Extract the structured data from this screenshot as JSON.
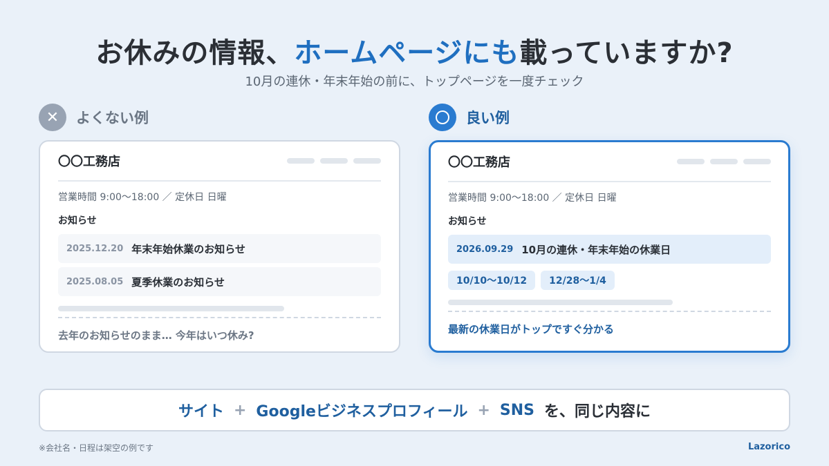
{
  "title": {
    "part1": "お休みの情報、",
    "accent": "ホームページにも",
    "part2": "載っていますか?"
  },
  "subtitle": "10月の連休・年末年始の前に、トップページを一度チェック",
  "bad": {
    "badge_icon": "✕",
    "label": "よくない例",
    "site_name": "〇〇工務店",
    "hours": "営業時間 9:00〜18:00 ／ 定休日 日曜",
    "notice_heading": "お知らせ",
    "news": [
      {
        "date": "2025.12.20",
        "text": "年末年始休業のお知らせ"
      },
      {
        "date": "2025.08.05",
        "text": "夏季休業のお知らせ"
      }
    ],
    "footer": "去年のお知らせのまま… 今年はいつ休み?"
  },
  "good": {
    "label": "良い例",
    "site_name": "〇〇工務店",
    "hours": "営業時間 9:00〜18:00 ／ 定休日 日曜",
    "notice_heading": "お知らせ",
    "news": [
      {
        "date": "2026.09.29",
        "text": "10月の連休・年末年始の休業日"
      }
    ],
    "tags": [
      "10/10〜10/12",
      "12/28〜1/4"
    ],
    "footer": "最新の休業日がトップですぐ分かる"
  },
  "banner": {
    "site": "サイト",
    "plus": "+",
    "google": "Googleビジネスプロフィール",
    "sns": "SNS",
    "suffix": "を、同じ内容に"
  },
  "note": "※会社名・日程は架空の例です",
  "brand": "Lazorico",
  "colors": {
    "accent": "#1f6fc0",
    "good_border": "#2a7bd0",
    "bad_badge": "#98a3b3",
    "background": "#eaf1f9"
  }
}
